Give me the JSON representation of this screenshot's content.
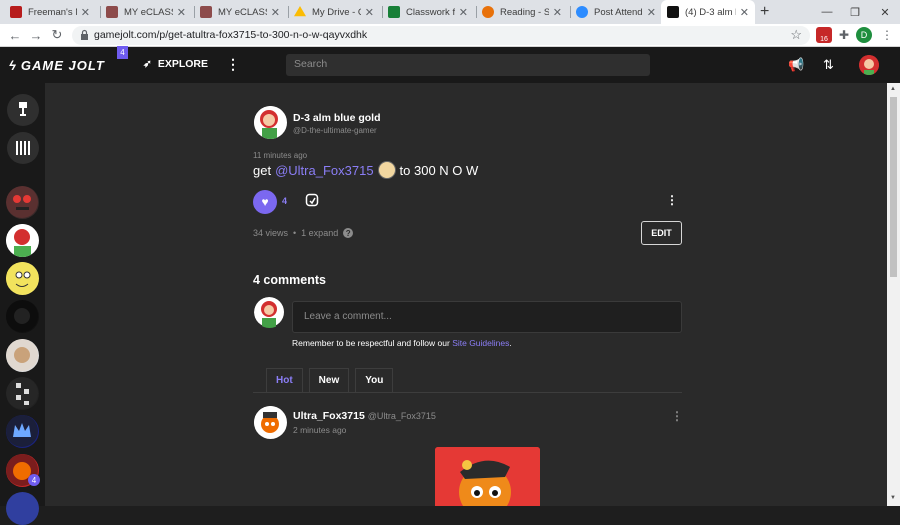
{
  "browser": {
    "tabs": [
      {
        "title": "Freeman's Mill",
        "color": "#b71c1c"
      },
      {
        "title": "MY eCLASS | G",
        "color": "#8d4b4b"
      },
      {
        "title": "MY eCLASS | G",
        "color": "#8d4b4b"
      },
      {
        "title": "My Drive - Goo",
        "color": "#fbbc04"
      },
      {
        "title": "Classwork for M",
        "color": "#188038"
      },
      {
        "title": "Reading - Septe",
        "color": "#e8710a"
      },
      {
        "title": "Post Attendee",
        "color": "#2d8cff"
      },
      {
        "title": "(4) D-3 alm blu",
        "color": "#111111"
      }
    ],
    "url": "gamejolt.com/p/get-atultra-fox3715-to-300-n-o-w-qayvxdhk",
    "profile_initial": "D",
    "extension_badge": "16"
  },
  "gj": {
    "logo_text": "GAME JOLT",
    "logo_badge": "4",
    "explore_label": "EXPLORE",
    "search_placeholder": "Search"
  },
  "sidebar": {
    "notification_badge": "4"
  },
  "post": {
    "author_name": "D-3 alm blue gold",
    "author_handle": "@D-the-ultimate-gamer",
    "time": "11 minutes ago",
    "text_before": "get",
    "mention": "@Ultra_Fox3715",
    "text_after": "to 300 N O W",
    "like_count": "4",
    "views": "34 views",
    "dot": "•",
    "expands": "1 expand",
    "edit_label": "EDIT"
  },
  "comments": {
    "heading": "4 comments",
    "input_placeholder": "Leave a comment...",
    "guideline_text": "Remember to be respectful and follow our",
    "guideline_link": "Site Guidelines",
    "guideline_end": ".",
    "tabs": [
      "Hot",
      "New",
      "You"
    ],
    "first": {
      "name": "Ultra_Fox3715",
      "handle": "@Ultra_Fox3715",
      "time": "2 minutes ago"
    }
  }
}
